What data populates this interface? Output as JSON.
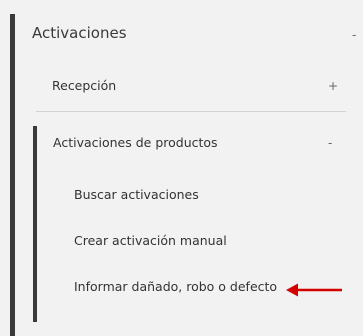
{
  "menu": {
    "section": {
      "label": "Activaciones",
      "toggle": "-"
    },
    "reception": {
      "label": "Recepción",
      "toggle": "+"
    },
    "product_activations": {
      "label": "Activaciones de productos",
      "toggle": "-",
      "items": [
        {
          "label": "Buscar activaciones"
        },
        {
          "label": "Crear activación manual"
        },
        {
          "label": "Informar dañado, robo o defecto"
        }
      ]
    }
  },
  "annotation": {
    "arrow_color": "#d40000",
    "arrow_icon": "left-arrow-icon"
  },
  "colors": {
    "background": "#f2f2f2",
    "bar": "#3a3a3a",
    "divider": "#d2d2d2"
  }
}
